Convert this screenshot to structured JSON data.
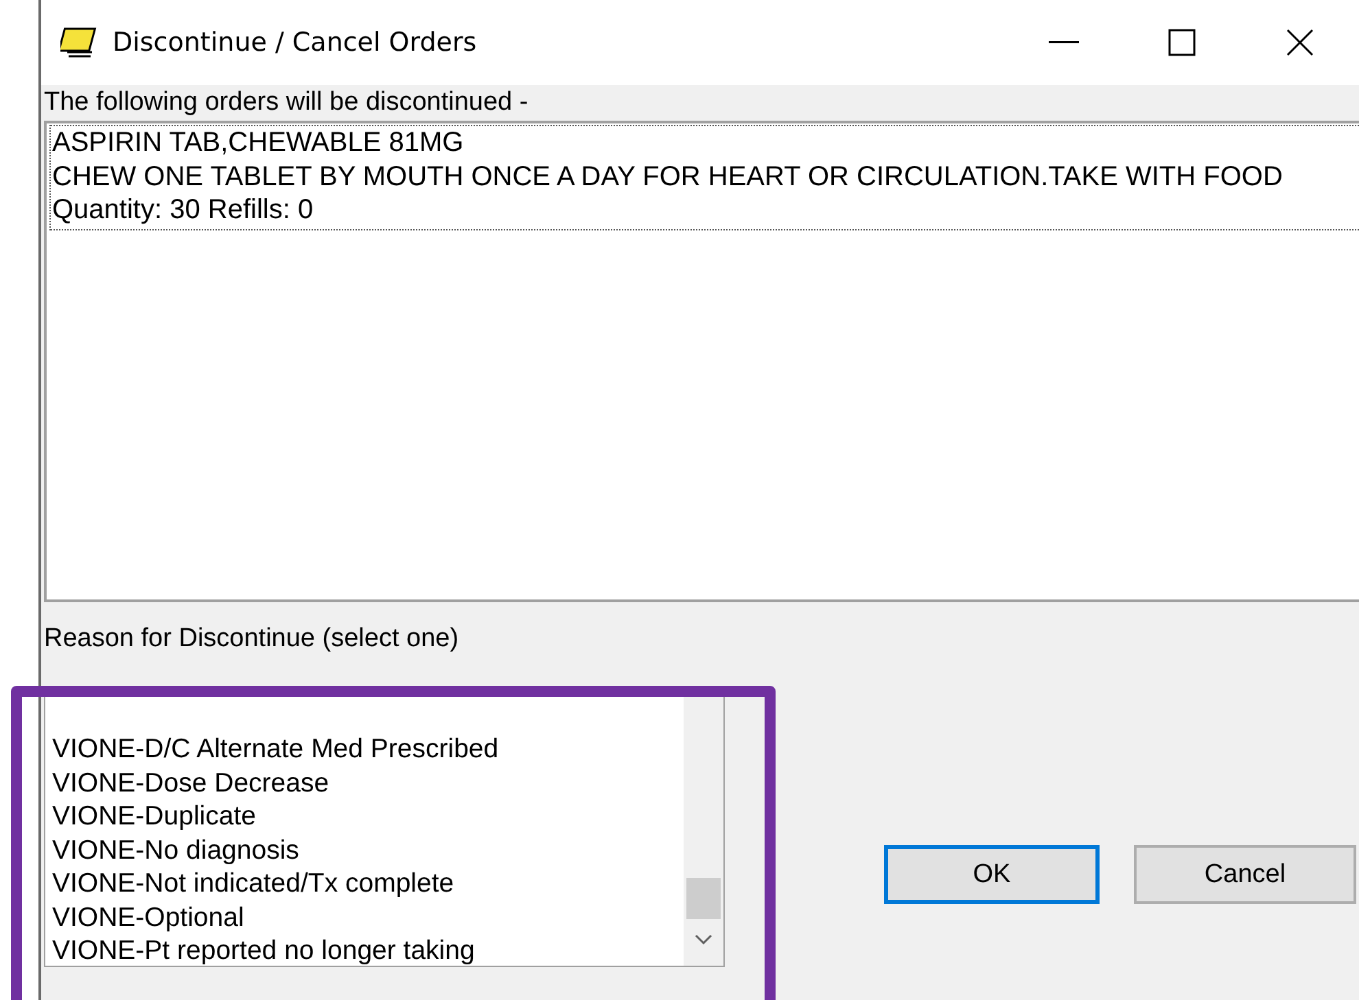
{
  "window": {
    "title": "Discontinue / Cancel Orders"
  },
  "orders_label": "The following orders will be discontinued -",
  "orders": [
    {
      "lines": [
        "ASPIRIN TAB,CHEWABLE  81MG",
        "CHEW ONE TABLET BY MOUTH ONCE A DAY FOR HEART OR CIRCULATION.TAKE WITH FOOD",
        "Quantity: 30 Refills: 0"
      ],
      "focused": true
    }
  ],
  "reason_label": "Reason for Discontinue (select one)",
  "reasons": [
    {
      "label": "VIONE-D/C Alternate Med Prescribed",
      "selected": false
    },
    {
      "label": "VIONE-Dose Decrease",
      "selected": false
    },
    {
      "label": "VIONE-Duplicate",
      "selected": false
    },
    {
      "label": "VIONE-No diagnosis",
      "selected": false
    },
    {
      "label": "VIONE-Not indicated/Tx complete",
      "selected": false
    },
    {
      "label": "VIONE-Optional",
      "selected": false
    },
    {
      "label": "VIONE-Pt reported no longer taking",
      "selected": false
    }
  ],
  "buttons": [
    {
      "label": "OK",
      "default": true
    },
    {
      "label": "Cancel",
      "default": false
    }
  ]
}
